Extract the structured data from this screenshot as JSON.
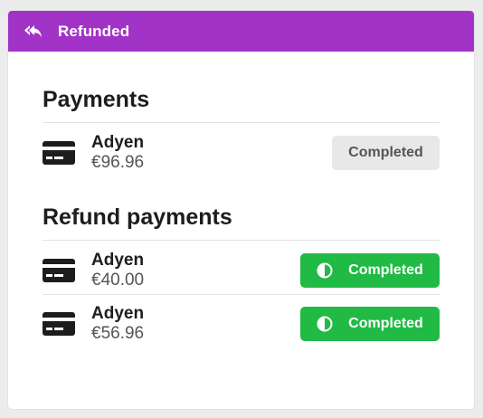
{
  "header": {
    "icon": "reply-all-icon",
    "title": "Refunded",
    "color": "#a233c7"
  },
  "payments": {
    "title": "Payments",
    "items": [
      {
        "icon": "credit-card-icon",
        "provider": "Adyen",
        "amount": "€96.96",
        "status": "Completed",
        "status_style": "grey"
      }
    ]
  },
  "refund_payments": {
    "title": "Refund payments",
    "items": [
      {
        "icon": "credit-card-icon",
        "provider": "Adyen",
        "amount": "€40.00",
        "status": "Completed",
        "status_icon": "adjust-icon",
        "status_style": "green"
      },
      {
        "icon": "credit-card-icon",
        "provider": "Adyen",
        "amount": "€56.96",
        "status": "Completed",
        "status_icon": "adjust-icon",
        "status_style": "green"
      }
    ]
  },
  "colors": {
    "header": "#a233c7",
    "success": "#21ba45",
    "neutral_badge": "#e8e8e8"
  }
}
